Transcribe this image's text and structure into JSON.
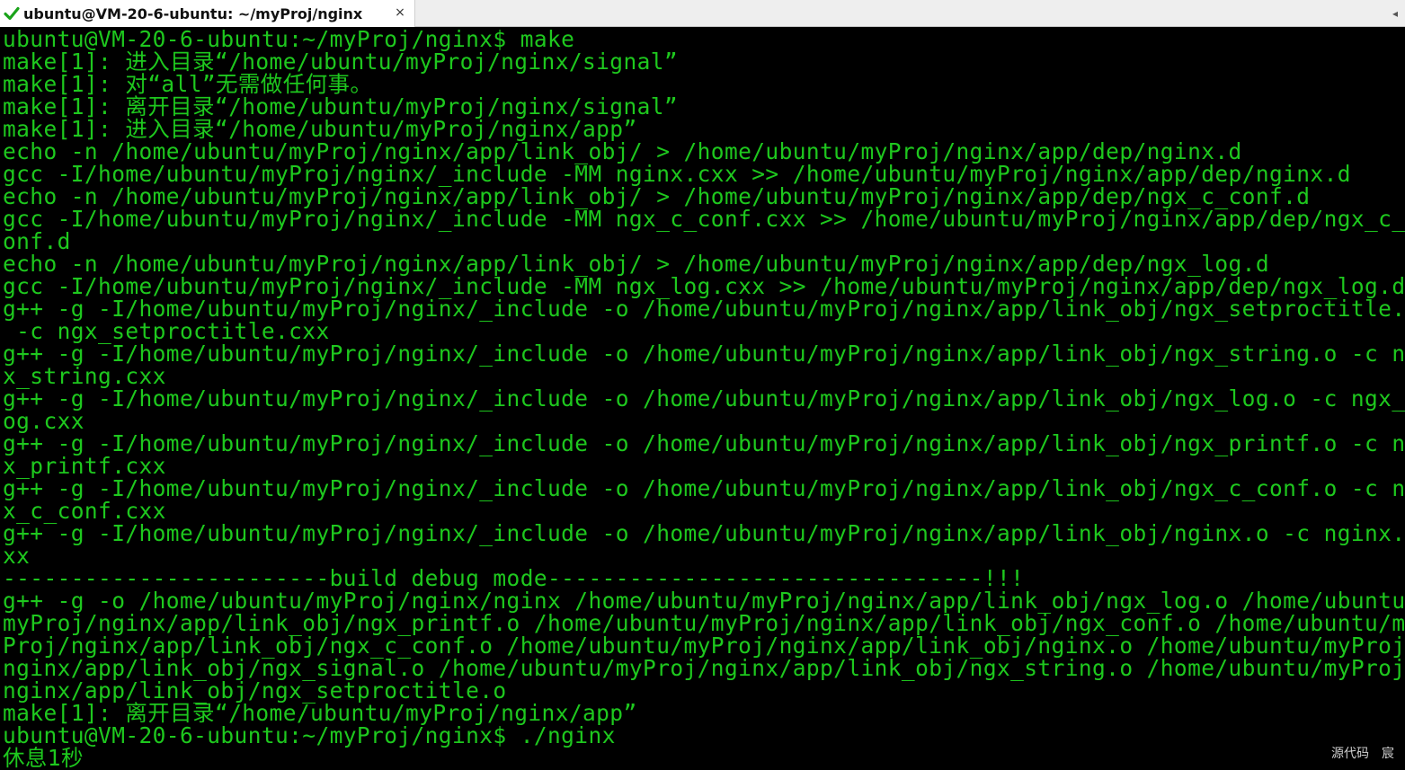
{
  "window": {
    "tab_title": "ubuntu@VM-20-6-ubuntu: ~/myProj/nginx",
    "tab_status_icon": "check-icon",
    "tab_close_glyph": "×",
    "tab_scroll_glyph": "◂",
    "status_color": "#1aa31a"
  },
  "terminal": {
    "text_color": "#1ec81e",
    "background": "#000000",
    "lines": [
      "ubuntu@VM-20-6-ubuntu:~/myProj/nginx$ make",
      "make[1]: 进入目录“/home/ubuntu/myProj/nginx/signal”",
      "make[1]: 对“all”无需做任何事。",
      "make[1]: 离开目录“/home/ubuntu/myProj/nginx/signal”",
      "make[1]: 进入目录“/home/ubuntu/myProj/nginx/app”",
      "echo -n /home/ubuntu/myProj/nginx/app/link_obj/ > /home/ubuntu/myProj/nginx/app/dep/nginx.d",
      "gcc -I/home/ubuntu/myProj/nginx/_include -MM nginx.cxx >> /home/ubuntu/myProj/nginx/app/dep/nginx.d",
      "echo -n /home/ubuntu/myProj/nginx/app/link_obj/ > /home/ubuntu/myProj/nginx/app/dep/ngx_c_conf.d",
      "gcc -I/home/ubuntu/myProj/nginx/_include -MM ngx_c_conf.cxx >> /home/ubuntu/myProj/nginx/app/dep/ngx_c_c",
      "onf.d",
      "echo -n /home/ubuntu/myProj/nginx/app/link_obj/ > /home/ubuntu/myProj/nginx/app/dep/ngx_log.d",
      "gcc -I/home/ubuntu/myProj/nginx/_include -MM ngx_log.cxx >> /home/ubuntu/myProj/nginx/app/dep/ngx_log.d",
      "g++ -g -I/home/ubuntu/myProj/nginx/_include -o /home/ubuntu/myProj/nginx/app/link_obj/ngx_setproctitle.o",
      " -c ngx_setproctitle.cxx",
      "g++ -g -I/home/ubuntu/myProj/nginx/_include -o /home/ubuntu/myProj/nginx/app/link_obj/ngx_string.o -c ng",
      "x_string.cxx",
      "g++ -g -I/home/ubuntu/myProj/nginx/_include -o /home/ubuntu/myProj/nginx/app/link_obj/ngx_log.o -c ngx_l",
      "og.cxx",
      "g++ -g -I/home/ubuntu/myProj/nginx/_include -o /home/ubuntu/myProj/nginx/app/link_obj/ngx_printf.o -c ng",
      "x_printf.cxx",
      "g++ -g -I/home/ubuntu/myProj/nginx/_include -o /home/ubuntu/myProj/nginx/app/link_obj/ngx_c_conf.o -c ng",
      "x_c_conf.cxx",
      "g++ -g -I/home/ubuntu/myProj/nginx/_include -o /home/ubuntu/myProj/nginx/app/link_obj/nginx.o -c nginx.c",
      "xx",
      "------------------------build debug mode--------------------------------!!!",
      "g++ -g -o /home/ubuntu/myProj/nginx/nginx /home/ubuntu/myProj/nginx/app/link_obj/ngx_log.o /home/ubuntu/",
      "myProj/nginx/app/link_obj/ngx_printf.o /home/ubuntu/myProj/nginx/app/link_obj/ngx_conf.o /home/ubuntu/my",
      "Proj/nginx/app/link_obj/ngx_c_conf.o /home/ubuntu/myProj/nginx/app/link_obj/nginx.o /home/ubuntu/myProj/",
      "nginx/app/link_obj/ngx_signal.o /home/ubuntu/myProj/nginx/app/link_obj/ngx_string.o /home/ubuntu/myProj/",
      "nginx/app/link_obj/ngx_setproctitle.o",
      "make[1]: 离开目录“/home/ubuntu/myProj/nginx/app”",
      "ubuntu@VM-20-6-ubuntu:~/myProj/nginx$ ./nginx",
      "休息1秒"
    ]
  },
  "ime": {
    "label1": "源代码",
    "label2": "宸"
  }
}
